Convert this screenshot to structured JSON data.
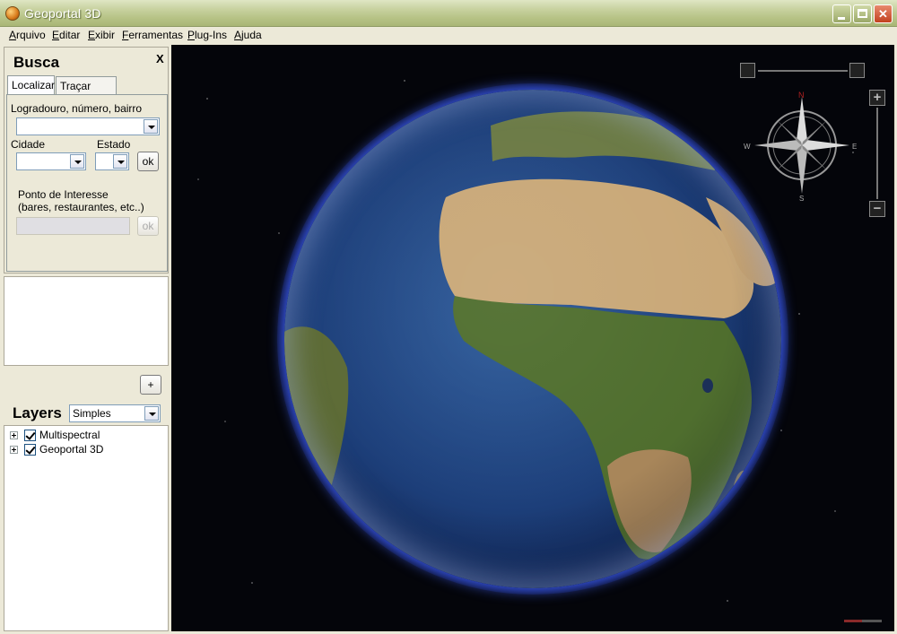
{
  "window": {
    "title": "Geoportal 3D"
  },
  "menu": {
    "items": [
      {
        "label": "Arquivo",
        "u": "A",
        "rest": "rquivo"
      },
      {
        "label": "Editar",
        "u": "E",
        "rest": "ditar"
      },
      {
        "label": "Exibir",
        "u": "E",
        "rest": "xibir"
      },
      {
        "label": "Ferramentas",
        "u": "F",
        "rest": "erramentas"
      },
      {
        "label": "Plug-Ins",
        "u": "P",
        "rest": "lug-Ins"
      },
      {
        "label": "Ajuda",
        "u": "A",
        "rest": "juda"
      }
    ]
  },
  "busca": {
    "title": "Busca",
    "close": "X",
    "tabs": [
      "Localizar",
      "Traçar Rota"
    ],
    "address_label": "Logradouro, número, bairro",
    "address_value": "",
    "cidade_label": "Cidade",
    "cidade_value": "",
    "estado_label": "Estado",
    "estado_value": "",
    "ok_label": "ok",
    "poi_label_1": "Ponto de Interesse",
    "poi_label_2": "(bares, restaurantes, etc..)",
    "poi_value": "",
    "poi_ok_label": "ok"
  },
  "add_button": "+",
  "layers": {
    "title": "Layers",
    "mode_value": "Simples",
    "items": [
      {
        "label": "Multispectral",
        "checked": true
      },
      {
        "label": "Geoportal 3D",
        "checked": true
      }
    ]
  },
  "viewer": {
    "compass_labels": {
      "n": "N",
      "s": "S",
      "e": "E",
      "w": "W"
    },
    "zoom_in": "+",
    "zoom_out": "−"
  },
  "colors": {
    "titlebar": "#b6c285",
    "chrome": "#ece9d8",
    "space": "#04050a"
  }
}
